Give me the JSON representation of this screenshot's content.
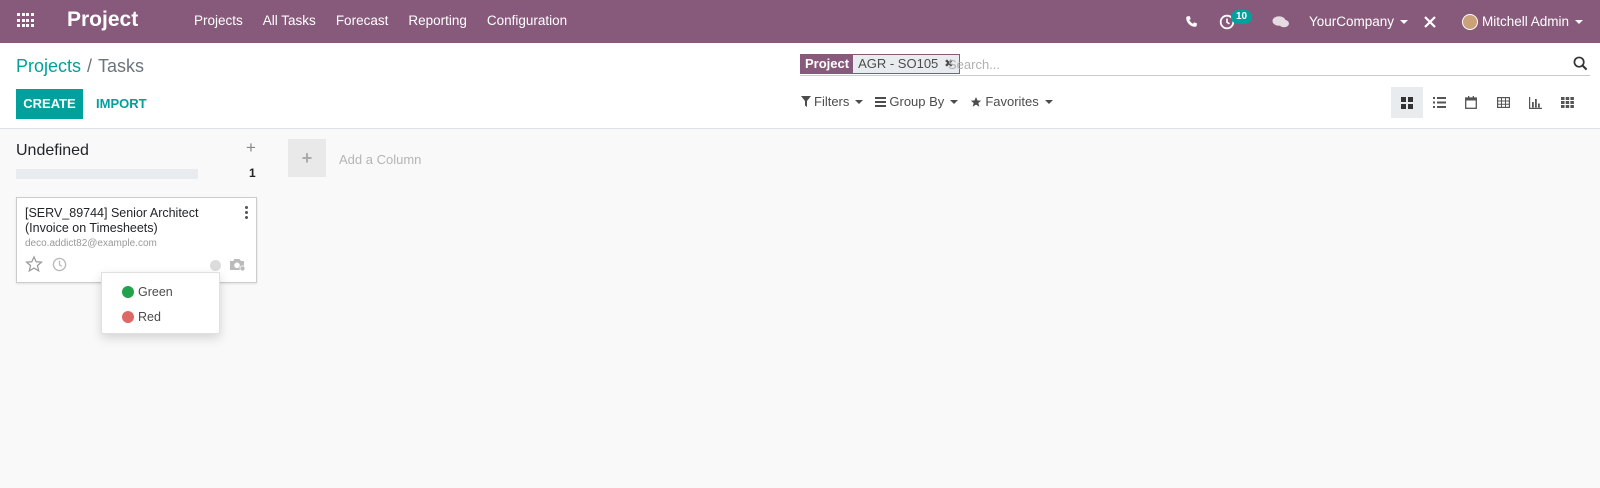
{
  "navbar": {
    "brand": "Project",
    "menu": [
      "Projects",
      "All Tasks",
      "Forecast",
      "Reporting",
      "Configuration"
    ],
    "activity_count": "10",
    "company": "YourCompany",
    "user": "Mitchell Admin"
  },
  "breadcrumb": {
    "parent": "Projects",
    "separator": "/",
    "current": "Tasks"
  },
  "actions": {
    "create": "CREATE",
    "import": "IMPORT"
  },
  "search": {
    "facet_label": "Project",
    "facet_value": "AGR - SO105",
    "placeholder": "Search..."
  },
  "filters": {
    "filters_label": "Filters",
    "groupby_label": "Group By",
    "favorites_label": "Favorites"
  },
  "kanban": {
    "column": {
      "title": "Undefined",
      "count": "1"
    },
    "card": {
      "title": "[SERV_89744] Senior Architect (Invoice on Timesheets)",
      "email": "deco.addict82@example.com"
    },
    "state_menu": {
      "items": [
        {
          "label": "Green",
          "color": "#21a24b"
        },
        {
          "label": "Red",
          "color": "#dc6965"
        }
      ]
    },
    "add_column_label": "Add a Column"
  },
  "colors": {
    "navbar": "#875a7b",
    "primary": "#00a09d"
  }
}
